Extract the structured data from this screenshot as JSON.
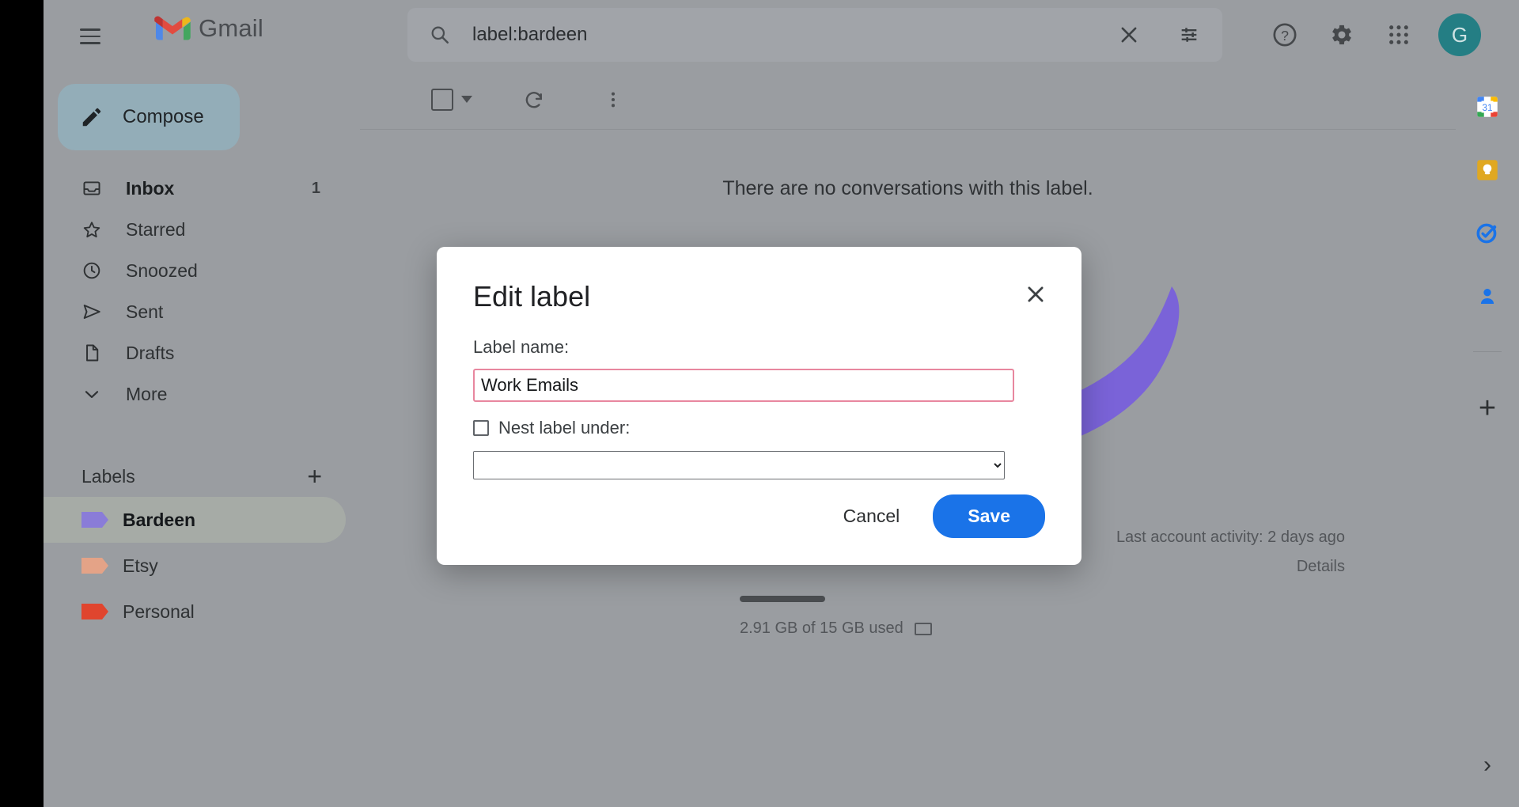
{
  "app": {
    "brand": "Gmail",
    "account_initial": "G"
  },
  "header": {
    "menu_icon": "hamburger-icon",
    "search": {
      "icon": "search-icon",
      "value": "label:bardeen",
      "clear_icon": "close-icon",
      "options_icon": "search-options-icon"
    },
    "help_icon": "help-icon",
    "settings_icon": "gear-icon",
    "apps_icon": "apps-grid-icon"
  },
  "sidebar": {
    "compose": {
      "label": "Compose",
      "icon": "pencil-icon"
    },
    "nav": [
      {
        "label": "Inbox",
        "icon": "inbox-icon",
        "count": "1",
        "active": true
      },
      {
        "label": "Starred",
        "icon": "star-icon",
        "count": ""
      },
      {
        "label": "Snoozed",
        "icon": "clock-icon",
        "count": ""
      },
      {
        "label": "Sent",
        "icon": "send-icon",
        "count": ""
      },
      {
        "label": "Drafts",
        "icon": "draft-icon",
        "count": ""
      },
      {
        "label": "More",
        "icon": "chevron-down-icon",
        "count": ""
      }
    ],
    "labels_header": {
      "title": "Labels",
      "add_icon": "plus-icon"
    },
    "labels": [
      {
        "label": "Bardeen",
        "color": "#8a7cd8",
        "active": true
      },
      {
        "label": "Etsy",
        "color": "#e4a387",
        "active": false
      },
      {
        "label": "Personal",
        "color": "#e0452e",
        "active": false
      }
    ]
  },
  "toolbar": {
    "select_all_icon": "checkbox-icon",
    "select_caret_icon": "chevron-down-icon",
    "refresh_icon": "refresh-icon",
    "more_icon": "more-vertical-icon"
  },
  "main": {
    "empty_message": "There are no conversations with this label.",
    "storage_text": "2.91 GB of 15 GB used",
    "last_activity": "Last account activity: 2 days ago",
    "details_link": "Details"
  },
  "rail": {
    "items": [
      {
        "name": "calendar-icon",
        "badge": "31"
      },
      {
        "name": "keep-icon",
        "badge": ""
      },
      {
        "name": "tasks-icon",
        "badge": ""
      },
      {
        "name": "contacts-icon",
        "badge": ""
      }
    ],
    "add_icon": "plus-icon",
    "expand_icon": "chevron-right-icon"
  },
  "modal": {
    "title": "Edit label",
    "close_icon": "close-icon",
    "label_name_caption": "Label name:",
    "label_name_value": "Work Emails",
    "nest_checkbox_label": "Nest label under:",
    "nest_checked": false,
    "nest_select_value": "",
    "nest_select_options": [
      ""
    ],
    "cancel_label": "Cancel",
    "save_label": "Save"
  },
  "annotation": {
    "arrow_color": "#7a63d8",
    "arrow_name": "purple-pointer-arrow"
  }
}
